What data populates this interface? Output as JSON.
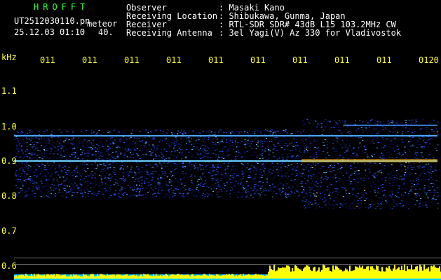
{
  "header": {
    "brand": "HROFFT",
    "filename": "UT2512030110.pn",
    "mode": "meteor",
    "datetime": "25.12.03 01:10",
    "count": "40.",
    "info_labels": [
      "Observer",
      "Receiving Location",
      "Receiver",
      "Receiving Antenna"
    ],
    "info_values": [
      ": Masaki Kano",
      ": Shibukawa, Gunma, Japan",
      ": RTL-SDR SDR# 43dB L15 103.2MHz CW",
      ": 3el Yagi(V) Az 330 for Vladivostok"
    ]
  },
  "axis": {
    "unit": "kHz",
    "freq_labels": [
      "1.1",
      "1.0",
      "0.9",
      "0.8",
      "0.7",
      "0.6"
    ],
    "time_labels": [
      "011",
      "011",
      "011",
      "011",
      "011",
      "011",
      "011",
      "011",
      "011",
      "0120"
    ]
  },
  "colors": {
    "background": "#000000",
    "header_text": "#ffffff",
    "brand": "#33ff33",
    "axis_labels": "#ffff33",
    "noise_dark": "#0a1a6e",
    "noise_mid": "#2a55ff",
    "signal": "#ffb300",
    "power_trace": "#ffff00",
    "power_base": "#00ccff"
  }
}
